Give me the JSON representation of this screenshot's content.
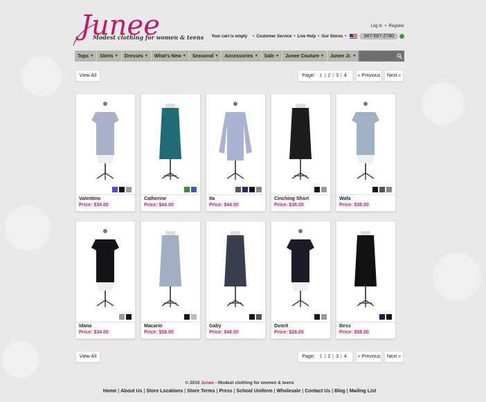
{
  "header": {
    "logo_text": "Junee",
    "tagline": "Modest clothing for women & teens",
    "login": "Log In",
    "register": "Register",
    "bullet": "•",
    "cart": "Your cart is empty",
    "customer_service": "Customer Service",
    "live_help": "Live Help",
    "our_stores": "Our Stores",
    "phone": "347-587-2780"
  },
  "nav": {
    "items": [
      "Tops",
      "Skirts",
      "Dresses",
      "What's New",
      "Seasonal",
      "Accessories",
      "Sale",
      "Junee Couture",
      "Junee Jr."
    ],
    "search_placeholder": "Search..."
  },
  "pager": {
    "view_all": "View All",
    "page_label": "Page:",
    "pages": [
      "1",
      "2",
      "3",
      "4"
    ],
    "separator": "|",
    "previous": "« Previous",
    "next": "Next »"
  },
  "products": [
    {
      "name": "Valentino",
      "price": "Price: $34.00",
      "swatches": [
        "#4a4ae0",
        "#111111",
        "#999999"
      ]
    },
    {
      "name": "Catherine",
      "price": "Price: $44.00",
      "swatches": [
        "#3a8a3a",
        "#3a5ab0"
      ]
    },
    {
      "name": "Ita",
      "price": "Price: $44.00",
      "swatches": [
        "#555555",
        "#1a2a8a",
        "#111111",
        "#888888"
      ]
    },
    {
      "name": "Cinching Short",
      "price": "Price: $38.00",
      "swatches": [
        "#111111",
        "#999999"
      ]
    },
    {
      "name": "Wafa",
      "price": "Price: $38.00",
      "swatches": [
        "#111111",
        "#555555",
        "#888888"
      ]
    },
    {
      "name": "Idana",
      "price": "Price: $34.00",
      "swatches": [
        "#999999",
        "#111111"
      ]
    },
    {
      "name": "Macario",
      "price": "Price: $58.00",
      "swatches": [
        "#111111",
        "#bbbbbb"
      ]
    },
    {
      "name": "Gaby",
      "price": "Price: $48.00",
      "swatches": [
        "#111111",
        "#555555"
      ]
    },
    {
      "name": "Dvorit",
      "price": "Price: $28.00",
      "swatches": [
        "#111111",
        "#999999"
      ]
    },
    {
      "name": "Bess",
      "price": "Price: $58.00",
      "swatches": [
        "#1a1a3a",
        "#111111"
      ]
    }
  ],
  "footer": {
    "copyright_prefix": "© 2010",
    "brand": "Junee",
    "copyright_suffix": "- Modest clothing for women & teens",
    "links": [
      "Home",
      "About Us",
      "Store Locations",
      "Store Terms",
      "Press",
      "School Uniform",
      "Wholesale",
      "Contact Us",
      "Blog",
      "Mailing List"
    ]
  },
  "colors": {
    "accent": "#c2186b",
    "nav_bg": "#b7b7b0",
    "page_bg": "#e9e9e9"
  }
}
